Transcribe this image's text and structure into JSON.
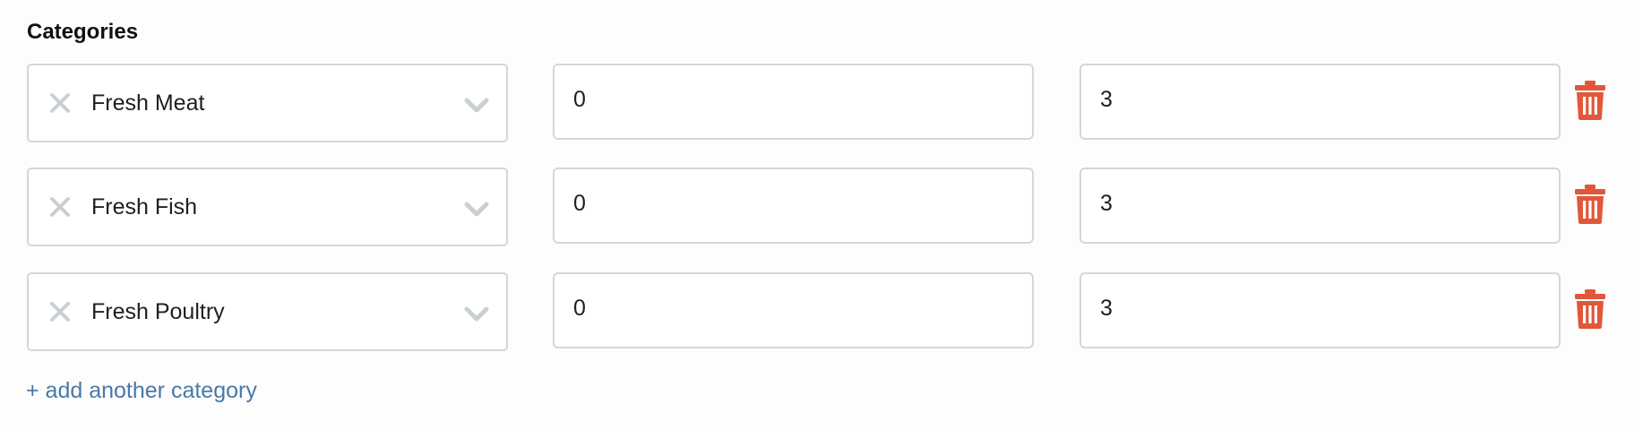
{
  "section": {
    "title": "Categories"
  },
  "categories": [
    {
      "name": "Fresh Meat",
      "min": "0",
      "max": "3"
    },
    {
      "name": "Fresh Fish",
      "min": "0",
      "max": "3"
    },
    {
      "name": "Fresh Poultry",
      "min": "0",
      "max": "3"
    }
  ],
  "add_link": {
    "label": "+ add another category"
  },
  "icons": {
    "clear": "close-icon",
    "dropdown": "chevron-down-icon",
    "delete": "trash-icon"
  },
  "colors": {
    "link": "#4a78a8",
    "delete": "#e0573a",
    "border": "#d3d7db",
    "muted_icon": "#c9d0d4"
  }
}
